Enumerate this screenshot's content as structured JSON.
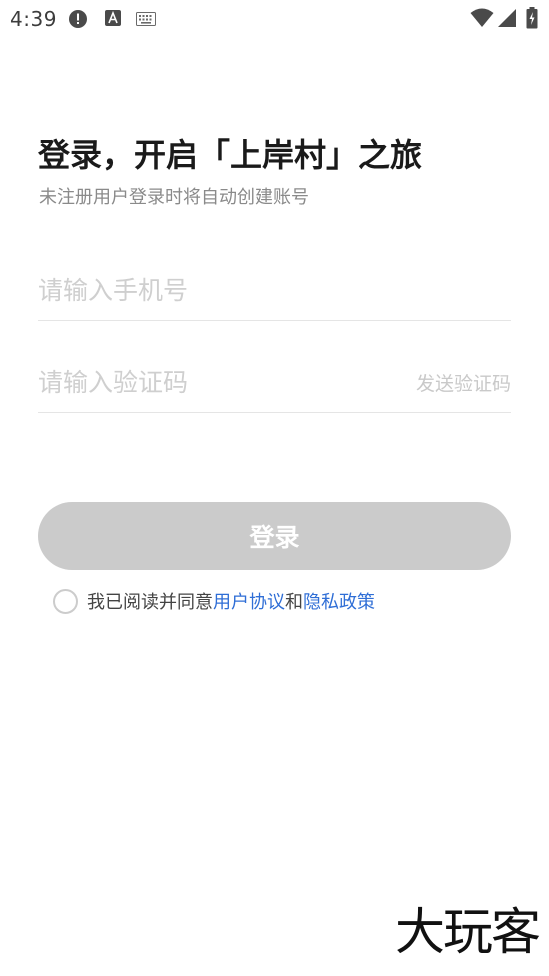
{
  "status_bar": {
    "time": "4:39",
    "icons": [
      "alert-icon",
      "font-a-icon",
      "keyboard-icon",
      "wifi-icon",
      "signal-icon",
      "battery-charging-icon"
    ]
  },
  "login": {
    "title": "登录，开启「上岸村」之旅",
    "subtitle": "未注册用户登录时将自动创建账号",
    "phone_placeholder": "请输入手机号",
    "code_placeholder": "请输入验证码",
    "send_code_label": "发送验证码",
    "login_button": "登录",
    "agreement": {
      "prefix": "我已阅读并同意",
      "user_agreement": "用户协议",
      "and": "和",
      "privacy_policy": "隐私政策"
    }
  },
  "watermark": "大玩客",
  "colors": {
    "link": "#2f6ed6",
    "button_disabled": "#cbcbcb",
    "placeholder": "#cfcfcf"
  }
}
